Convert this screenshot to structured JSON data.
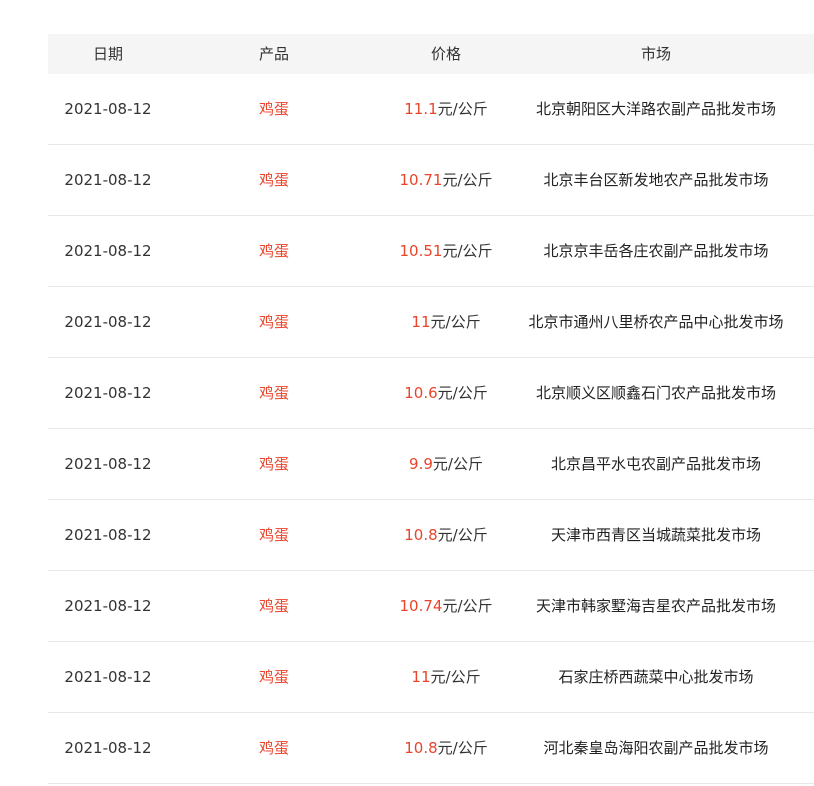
{
  "accent_color": "#e8452b",
  "header": {
    "date": "日期",
    "product": "产品",
    "price": "价格",
    "market": "市场"
  },
  "rows": [
    {
      "date": "2021-08-12",
      "product": "鸡蛋",
      "price": "11.1",
      "unit": "元/公斤",
      "market": "北京朝阳区大洋路农副产品批发市场"
    },
    {
      "date": "2021-08-12",
      "product": "鸡蛋",
      "price": "10.71",
      "unit": "元/公斤",
      "market": "北京丰台区新发地农产品批发市场"
    },
    {
      "date": "2021-08-12",
      "product": "鸡蛋",
      "price": "10.51",
      "unit": "元/公斤",
      "market": "北京京丰岳各庄农副产品批发市场"
    },
    {
      "date": "2021-08-12",
      "product": "鸡蛋",
      "price": "11",
      "unit": "元/公斤",
      "market": "北京市通州八里桥农产品中心批发市场"
    },
    {
      "date": "2021-08-12",
      "product": "鸡蛋",
      "price": "10.6",
      "unit": "元/公斤",
      "market": "北京顺义区顺鑫石门农产品批发市场"
    },
    {
      "date": "2021-08-12",
      "product": "鸡蛋",
      "price": "9.9",
      "unit": "元/公斤",
      "market": "北京昌平水屯农副产品批发市场"
    },
    {
      "date": "2021-08-12",
      "product": "鸡蛋",
      "price": "10.8",
      "unit": "元/公斤",
      "market": "天津市西青区当城蔬菜批发市场"
    },
    {
      "date": "2021-08-12",
      "product": "鸡蛋",
      "price": "10.74",
      "unit": "元/公斤",
      "market": "天津市韩家墅海吉星农产品批发市场"
    },
    {
      "date": "2021-08-12",
      "product": "鸡蛋",
      "price": "11",
      "unit": "元/公斤",
      "market": "石家庄桥西蔬菜中心批发市场"
    },
    {
      "date": "2021-08-12",
      "product": "鸡蛋",
      "price": "10.8",
      "unit": "元/公斤",
      "market": "河北秦皇岛海阳农副产品批发市场"
    }
  ]
}
